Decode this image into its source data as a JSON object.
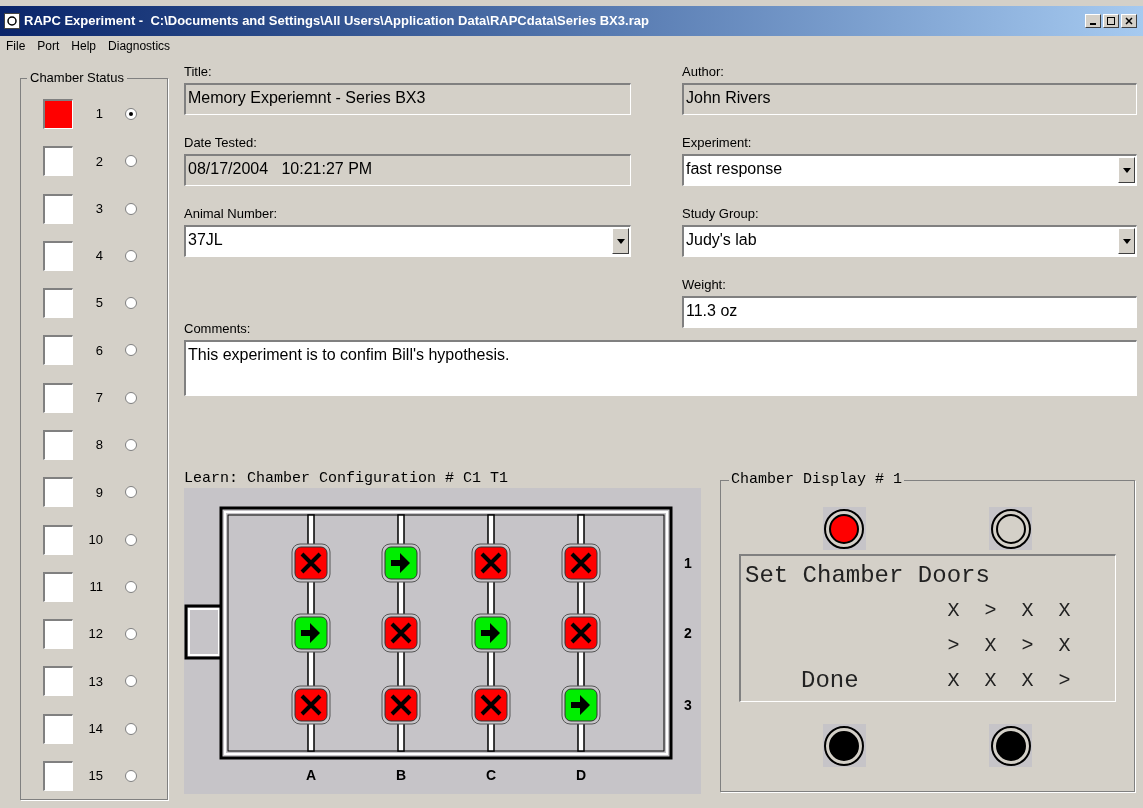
{
  "window": {
    "title": "RAPC Experiment -  C:\\Documents and Settings\\All Users\\Application Data\\RAPCdata\\Series BX3.rap"
  },
  "menu": [
    "File",
    "Port",
    "Help",
    "Diagnostics"
  ],
  "chamber_status": {
    "title": "Chamber Status",
    "items": [
      {
        "number": "1",
        "color": "#ff0000",
        "selected": true
      },
      {
        "number": "2",
        "color": "#ffffff",
        "selected": false
      },
      {
        "number": "3",
        "color": "#ffffff",
        "selected": false
      },
      {
        "number": "4",
        "color": "#ffffff",
        "selected": false
      },
      {
        "number": "5",
        "color": "#ffffff",
        "selected": false
      },
      {
        "number": "6",
        "color": "#ffffff",
        "selected": false
      },
      {
        "number": "7",
        "color": "#ffffff",
        "selected": false
      },
      {
        "number": "8",
        "color": "#ffffff",
        "selected": false
      },
      {
        "number": "9",
        "color": "#ffffff",
        "selected": false
      },
      {
        "number": "10",
        "color": "#ffffff",
        "selected": false
      },
      {
        "number": "11",
        "color": "#ffffff",
        "selected": false
      },
      {
        "number": "12",
        "color": "#ffffff",
        "selected": false
      },
      {
        "number": "13",
        "color": "#ffffff",
        "selected": false
      },
      {
        "number": "14",
        "color": "#ffffff",
        "selected": false
      },
      {
        "number": "15",
        "color": "#ffffff",
        "selected": false
      }
    ]
  },
  "fields": {
    "title": {
      "label": "Title:",
      "value": "Memory Experiemnt - Series BX3",
      "kind": "readonly"
    },
    "author": {
      "label": "Author:",
      "value": "John Rivers",
      "kind": "readonly"
    },
    "date_tested": {
      "label": "Date Tested:",
      "value": "08/17/2004   10:21:27 PM",
      "kind": "readonly"
    },
    "experiment": {
      "label": "Experiment:",
      "value": "fast response",
      "kind": "dropdown"
    },
    "animal_number": {
      "label": "Animal Number:",
      "value": "37JL",
      "kind": "dropdown"
    },
    "study_group": {
      "label": "Study Group:",
      "value": "Judy's lab",
      "kind": "dropdown"
    },
    "weight": {
      "label": "Weight:",
      "value": "11.3 oz",
      "kind": "text"
    },
    "comments": {
      "label": "Comments:",
      "value": "This experiment is to confim Bill's hypothesis.",
      "kind": "text"
    }
  },
  "configuration": {
    "label": "Learn: Chamber Configuration # C1 T1",
    "columns": [
      "A",
      "B",
      "C",
      "D"
    ],
    "rows": [
      {
        "label": "1",
        "doors": [
          {
            "kind": "closed"
          },
          {
            "kind": "open"
          },
          {
            "kind": "closed"
          },
          {
            "kind": "closed"
          }
        ]
      },
      {
        "label": "2",
        "doors": [
          {
            "kind": "open"
          },
          {
            "kind": "closed"
          },
          {
            "kind": "open"
          },
          {
            "kind": "closed"
          }
        ]
      },
      {
        "label": "3",
        "doors": [
          {
            "kind": "closed"
          },
          {
            "kind": "closed"
          },
          {
            "kind": "closed"
          },
          {
            "kind": "open"
          }
        ]
      }
    ]
  },
  "display": {
    "title": "Chamber Display # 1",
    "top_lights": [
      {
        "color": "#ff0000"
      },
      {
        "color": "#d4d0c8"
      }
    ],
    "bottom_lights": [
      {
        "color": "#000000"
      },
      {
        "color": "#000000"
      }
    ],
    "lines": [
      {
        "label": "Set Chamber Doors"
      },
      {
        "cells": [
          "X",
          ">",
          "X",
          "X"
        ]
      },
      {
        "cells": [
          ">",
          "X",
          ">",
          "X"
        ]
      },
      {
        "label": "Done",
        "cells": [
          "X",
          "X",
          "X",
          ">"
        ]
      }
    ]
  }
}
